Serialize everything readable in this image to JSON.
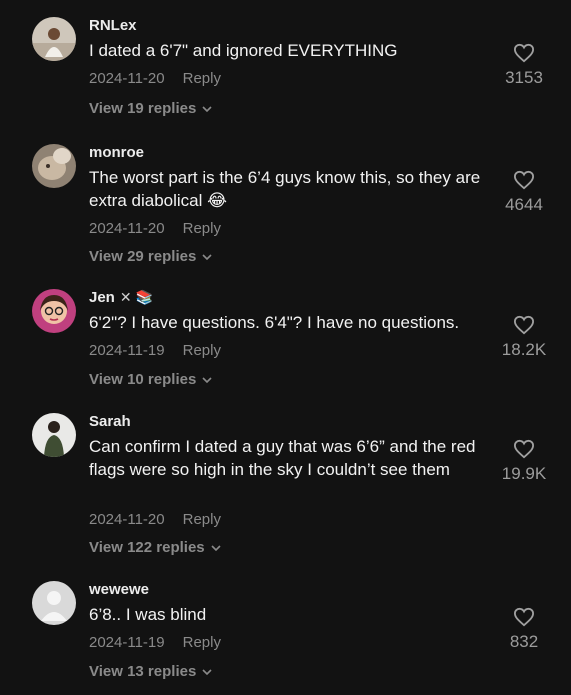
{
  "comments": [
    {
      "username": "RNLex",
      "text": "I dated a 6'7\" and ignored EVERYTHING",
      "date": "2024-11-20",
      "reply_label": "Reply",
      "view_replies": "View 19 replies",
      "likes": "3153",
      "avatar_color": "#c9c0b5"
    },
    {
      "username": "monroe",
      "text": "The worst part is the 6’4 guys know this, so they are extra diabolical 😂",
      "date": "2024-11-20",
      "reply_label": "Reply",
      "view_replies": "View 29 replies",
      "likes": "4644",
      "avatar_color": "#a99a86"
    },
    {
      "username": "Jen",
      "badge": "✕ 📚",
      "text": "6'2\"? I have questions. 6'4\"? I have no questions.",
      "date": "2024-11-19",
      "reply_label": "Reply",
      "view_replies": "View 10 replies",
      "likes": "18.2K",
      "avatar_color": "#d14a8f"
    },
    {
      "username": "Sarah",
      "text": "Can confirm I dated a guy that was 6’6” and the red flags were so high in the sky I couldn’t see them",
      "date": "2024-11-20",
      "reply_label": "Reply",
      "view_replies": "View 122 replies",
      "likes": "19.9K",
      "avatar_color": "#4b5a3d"
    },
    {
      "username": "wewewe",
      "text": "6’8.. I was blind",
      "date": "2024-11-19",
      "reply_label": "Reply",
      "view_replies": "View 13 replies",
      "likes": "832",
      "avatar_color": "#d9d9d9"
    }
  ]
}
